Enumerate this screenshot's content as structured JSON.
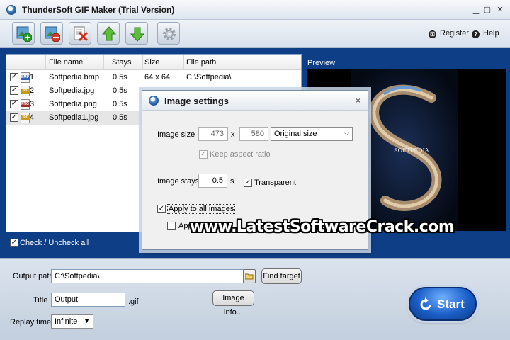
{
  "window": {
    "title": "ThunderSoft GIF Maker (Trial Version)"
  },
  "toolbar": {
    "buttons": [
      "add-image-icon",
      "remove-image-icon",
      "clear-list-icon",
      "move-up-icon",
      "move-down-icon",
      "settings-icon"
    ],
    "register_label": "Register",
    "help_label": "Help"
  },
  "file_list": {
    "columns": [
      "File name",
      "Stays",
      "Size",
      "File path"
    ],
    "rows": [
      {
        "index": "1",
        "type": "BMP",
        "type_color": "#2f5fb0",
        "name": "Softpedia.bmp",
        "stays": "0.5s",
        "size": "64 x 64",
        "path": "C:\\Softpedia\\"
      },
      {
        "index": "2",
        "type": "JPG",
        "type_color": "#c79a13",
        "name": "Softpedia.jpg",
        "stays": "0.5s",
        "size": "",
        "path": ""
      },
      {
        "index": "3",
        "type": "PNG",
        "type_color": "#9c2a2a",
        "name": "Softpedia.png",
        "stays": "0.5s",
        "size": "",
        "path": ""
      },
      {
        "index": "4",
        "type": "JPG",
        "type_color": "#c79a13",
        "name": "Softpedia1.jpg",
        "stays": "0.5s",
        "size": "",
        "path": ""
      }
    ],
    "check_all_label": "Check / Uncheck all"
  },
  "preview": {
    "label": "Preview",
    "overlay_text": "SOFTPEDIA"
  },
  "output": {
    "path_label": "Output path",
    "path_value": "C:\\Softpedia\\",
    "find_target_label": "Find target",
    "title_label": "Title",
    "title_value": "Output",
    "ext_label": ".gif",
    "image_info_label": "Image info...",
    "replay_label": "Replay times",
    "replay_value": "Infinite",
    "start_label": "Start"
  },
  "dialog": {
    "title": "Image settings",
    "close_label": "×",
    "size_label": "Image size",
    "width": "473",
    "x_label": "x",
    "height": "580",
    "size_mode": "Original size",
    "keep_aspect_label": "Keep aspect ratio",
    "stays_label": "Image stays",
    "stays_value": "0.5",
    "stays_unit": "s",
    "transparent_label": "Transparent",
    "apply_all_label": "Apply to all images",
    "apply_partial_label": "App"
  },
  "watermark": "www.LatestSoftwareCrack.com"
}
